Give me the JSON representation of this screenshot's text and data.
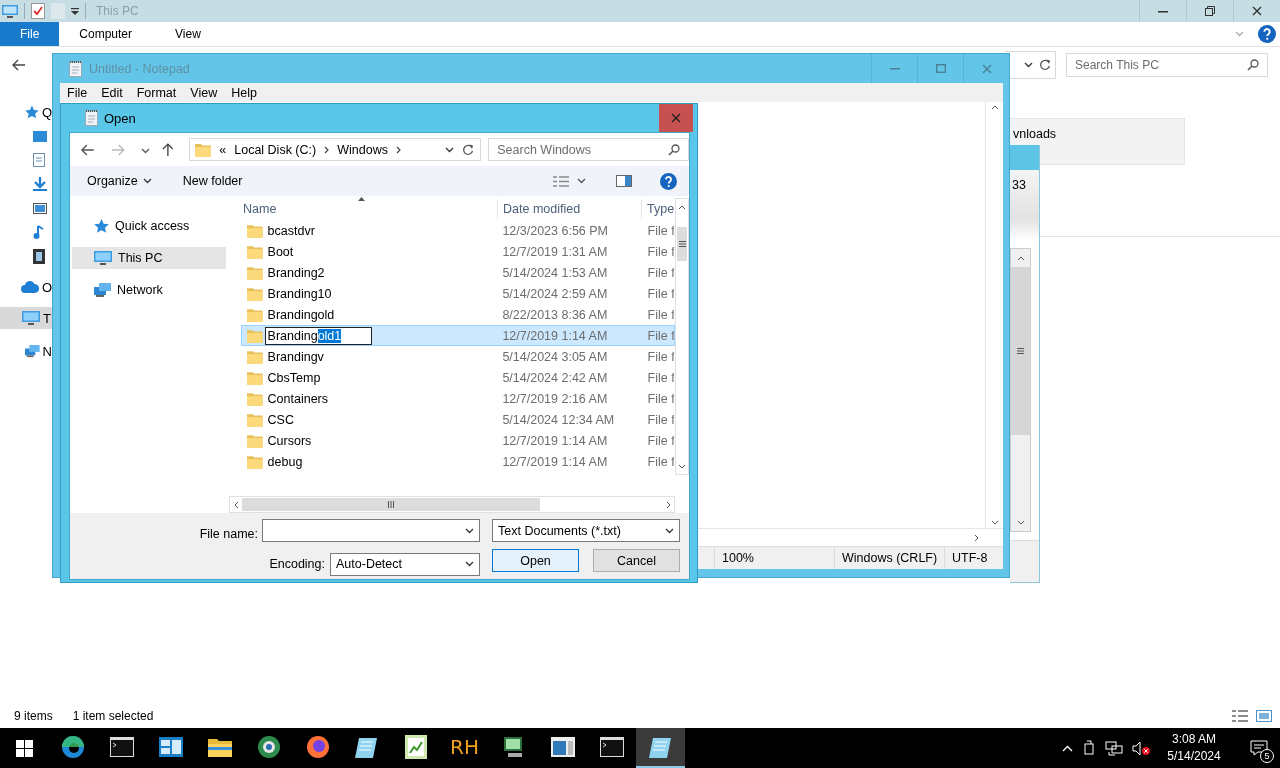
{
  "explorer": {
    "title": "This PC",
    "ribbon_tabs": [
      {
        "label": "File",
        "selected": true
      },
      {
        "label": "Computer",
        "selected": false
      },
      {
        "label": "View",
        "selected": false
      }
    ],
    "search": {
      "placeholder": "Search This PC"
    },
    "nav_items": [
      {
        "label": "Q",
        "kind": "star",
        "selected": false
      },
      {
        "label": "O",
        "kind": "cloud",
        "selected": false
      },
      {
        "label": "T",
        "kind": "pc",
        "selected": true
      },
      {
        "label": "N",
        "kind": "network",
        "selected": false
      }
    ],
    "tile": {
      "label": "vnloads"
    },
    "status_bar": {
      "item_count": "9 items",
      "selection": "1 item selected"
    }
  },
  "background_window": {
    "text": "33"
  },
  "notepad": {
    "title": "Untitled - Notepad",
    "menu": [
      "File",
      "Edit",
      "Format",
      "View",
      "Help"
    ],
    "status_bar": [
      "100%",
      "Windows (CRLF)",
      "UTF-8"
    ]
  },
  "open_dialog": {
    "title": "Open",
    "breadcrumb": {
      "overflow": "«",
      "segments": [
        "Local Disk (C:)",
        "Windows"
      ]
    },
    "search": {
      "placeholder": "Search Windows"
    },
    "toolbar": {
      "organize": "Organize",
      "new_folder": "New folder"
    },
    "nav": [
      {
        "label": "Quick access",
        "kind": "star",
        "selected": false
      },
      {
        "label": "This PC",
        "kind": "pc",
        "selected": true
      },
      {
        "label": "Network",
        "kind": "network",
        "selected": false
      }
    ],
    "columns": [
      "Name",
      "Date modified",
      "Type"
    ],
    "rows": [
      {
        "kind": "folder",
        "name": "bcastdvr",
        "date": "12/3/2023 6:56 PM",
        "type": "File f",
        "selected": false
      },
      {
        "kind": "folder",
        "name": "Boot",
        "date": "12/7/2019 1:31 AM",
        "type": "File f",
        "selected": false
      },
      {
        "kind": "folder",
        "name": "Branding2",
        "date": "5/14/2024 1:53 AM",
        "type": "File f",
        "selected": false
      },
      {
        "kind": "folder",
        "name": "Branding10",
        "date": "5/14/2024 2:59 AM",
        "type": "File f",
        "selected": false
      },
      {
        "kind": "folder",
        "name": "Brandingold",
        "date": "8/22/2013 8:36 AM",
        "type": "File f",
        "selected": false
      },
      {
        "kind": "editing",
        "name": "Branding",
        "name_selection": "old1",
        "date": "12/7/2019 1:14 AM",
        "type": "File f",
        "selected": true
      },
      {
        "kind": "folder",
        "name": "Brandingv",
        "date": "5/14/2024 3:05 AM",
        "type": "File f",
        "selected": false
      },
      {
        "kind": "folder",
        "name": "CbsTemp",
        "date": "5/14/2024 2:42 AM",
        "type": "File f",
        "selected": false
      },
      {
        "kind": "folder",
        "name": "Containers",
        "date": "12/7/2019 2:16 AM",
        "type": "File f",
        "selected": false
      },
      {
        "kind": "folder",
        "name": "CSC",
        "date": "5/14/2024 12:34 AM",
        "type": "File f",
        "selected": false
      },
      {
        "kind": "folder",
        "name": "Cursors",
        "date": "12/7/2019 1:14 AM",
        "type": "File f",
        "selected": false
      },
      {
        "kind": "folder",
        "name": "debug",
        "date": "12/7/2019 1:14 AM",
        "type": "File f",
        "selected": false
      }
    ],
    "file_name": {
      "label": "File name:"
    },
    "file_type": {
      "value": "Text Documents (*.txt)"
    },
    "encoding": {
      "label": "Encoding:",
      "value": "Auto-Detect"
    },
    "buttons": [
      "Open",
      "Cancel"
    ]
  },
  "taskbar": {
    "apps": [
      {
        "kind": "browser",
        "selected": false
      },
      {
        "kind": "terminal",
        "selected": false
      },
      {
        "kind": "dashboard",
        "selected": false
      },
      {
        "kind": "folder",
        "selected": false
      },
      {
        "kind": "globe",
        "selected": false
      },
      {
        "kind": "firefox",
        "selected": false
      },
      {
        "kind": "notepad",
        "selected": false
      },
      {
        "kind": "chart",
        "selected": false
      },
      {
        "kind": "text",
        "label": "RH",
        "selected": false
      },
      {
        "kind": "computer",
        "selected": false
      },
      {
        "kind": "window",
        "selected": false
      },
      {
        "kind": "terminal",
        "selected": false
      },
      {
        "kind": "notepad",
        "selected": true
      }
    ],
    "time": "3:08 AM",
    "date": "5/14/2024",
    "notification_count": "5"
  }
}
